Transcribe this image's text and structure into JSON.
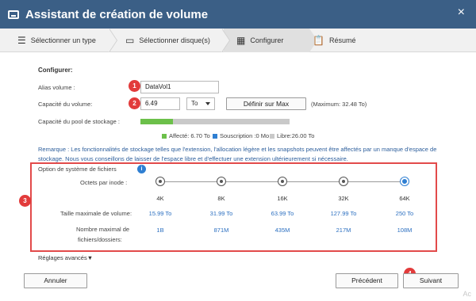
{
  "window": {
    "title": "Assistant de création de volume",
    "close": "×"
  },
  "steps": [
    {
      "label": "Sélectionner un type",
      "icon": "list-icon"
    },
    {
      "label": "Sélectionner disque(s)",
      "icon": "disk-icon"
    },
    {
      "label": "Configurer",
      "icon": "table-icon"
    },
    {
      "label": "Résumé",
      "icon": "clipboard-icon"
    }
  ],
  "config": {
    "section_title": "Configurer:",
    "alias_label": "Alias volume :",
    "alias_value": "DataVol1",
    "capacity_label": "Capacité du volume:",
    "capacity_value": "6.49",
    "unit_value": "To",
    "set_max_label": "Définir sur Max",
    "maximum_text": "(Maximum: 32.48 To)",
    "pool_label": "Capacité du pool de stockage :",
    "pool_used_fraction": 0.22,
    "legend": [
      {
        "label": "Affecté: 6.70 To",
        "color": "#6cc04a"
      },
      {
        "label": "Souscription :0 Mo",
        "color": "#2f7fd2"
      },
      {
        "label": "Libre:26.00 To",
        "color": "#c9c9c9"
      }
    ],
    "remark": "Remarque : Les fonctionnalités de stockage telles que l'extension, l'allocation légère et les snapshots peuvent être affectés par un manque d'espace de stockage. Nous vous conseillons de laisser de l'espace libre et d'effectuer une extension ultérieurement si nécessaire."
  },
  "filesystem": {
    "option_label": "Option de système de fichiers",
    "info": "i",
    "inode_label": "Octets par inode :",
    "max_volume_label": "Taille maximale de volume:",
    "max_files_label_1": "Nombre maximal de",
    "max_files_label_2": "fichiers/dossiers:",
    "options": [
      {
        "inode": "4K",
        "max_volume": "15.99 To",
        "max_files": "1B",
        "selected": false
      },
      {
        "inode": "8K",
        "max_volume": "31.99 To",
        "max_files": "871M",
        "selected": false
      },
      {
        "inode": "16K",
        "max_volume": "63.99 To",
        "max_files": "435M",
        "selected": false
      },
      {
        "inode": "32K",
        "max_volume": "127.99 To",
        "max_files": "217M",
        "selected": false
      },
      {
        "inode": "64K",
        "max_volume": "250 To",
        "max_files": "108M",
        "selected": true
      }
    ],
    "advanced": "Réglages avancés▼"
  },
  "badges": [
    "1",
    "2",
    "3",
    "4"
  ],
  "buttons": {
    "cancel": "Annuler",
    "previous": "Précédent",
    "next": "Suivant"
  },
  "watermark": "Ac"
}
